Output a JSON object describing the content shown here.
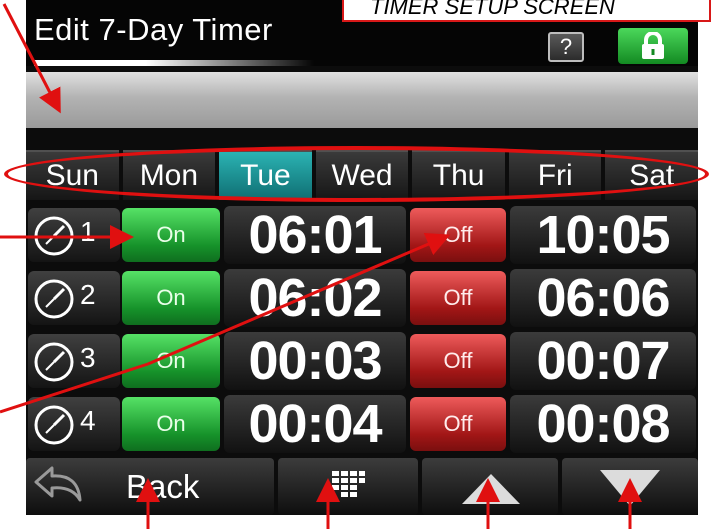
{
  "annotation": {
    "caption": "TIMER SETUP SCREEN"
  },
  "header": {
    "title": "Edit 7-Day Timer",
    "help_label": "?"
  },
  "message_bar": {
    "text": ""
  },
  "days": [
    {
      "label": "Sun",
      "selected": false
    },
    {
      "label": "Mon",
      "selected": false
    },
    {
      "label": "Tue",
      "selected": true
    },
    {
      "label": "Wed",
      "selected": false
    },
    {
      "label": "Thu",
      "selected": false
    },
    {
      "label": "Fri",
      "selected": false
    },
    {
      "label": "Sat",
      "selected": false
    }
  ],
  "timers": [
    {
      "number": "1",
      "on_label": "On",
      "on_time": "06:01",
      "off_label": "Off",
      "off_time": "10:05"
    },
    {
      "number": "2",
      "on_label": "On",
      "on_time": "06:02",
      "off_label": "Off",
      "off_time": "06:06"
    },
    {
      "number": "3",
      "on_label": "On",
      "on_time": "00:03",
      "off_label": "Off",
      "off_time": "00:07"
    },
    {
      "number": "4",
      "on_label": "On",
      "on_time": "00:04",
      "off_label": "Off",
      "off_time": "00:08"
    }
  ],
  "footer": {
    "back_label": "Back"
  },
  "colors": {
    "on_green": "#16922a",
    "off_red": "#a11616",
    "selected_teal": "#1b9a9e",
    "annotation_red": "#e01010"
  },
  "icons": [
    "lock-icon",
    "help-icon",
    "clock-icon",
    "back-arrow-icon",
    "keypad-icon",
    "up-arrow-icon",
    "down-arrow-icon"
  ]
}
